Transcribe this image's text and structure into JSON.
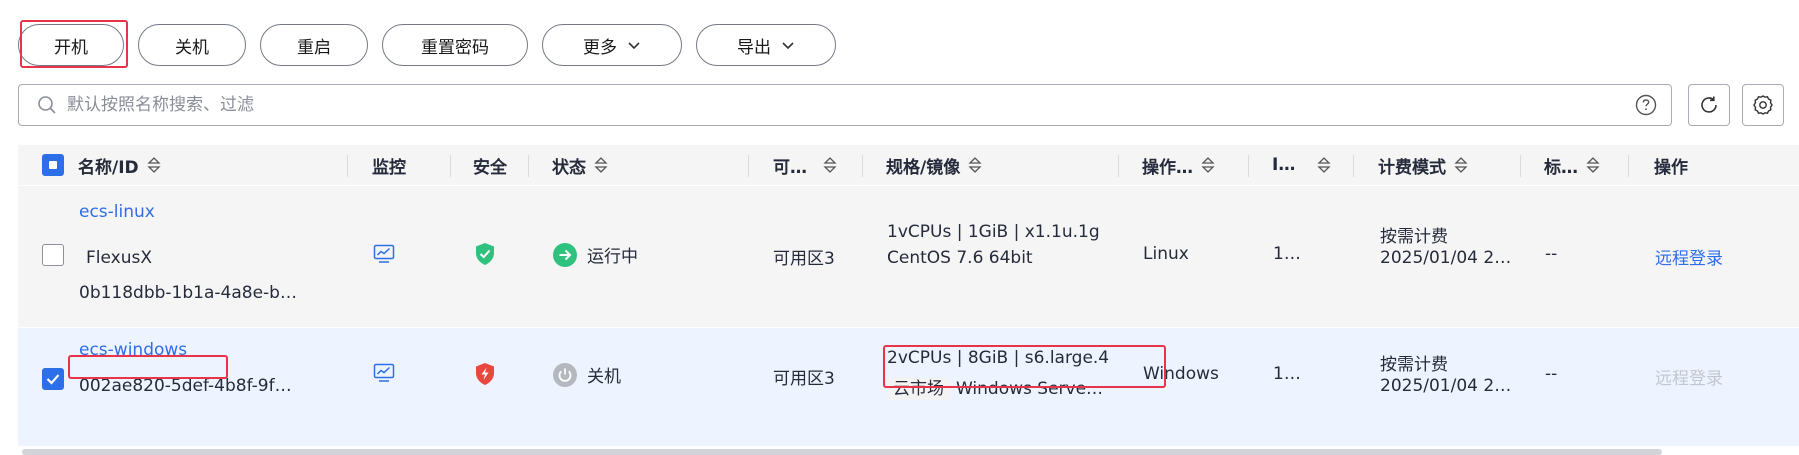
{
  "toolbar": {
    "start": "开机",
    "stop": "关机",
    "reboot": "重启",
    "reset_password": "重置密码",
    "more": "更多",
    "export": "导出"
  },
  "search": {
    "placeholder": "默认按照名称搜索、过滤"
  },
  "table": {
    "headers": {
      "name": "名称/ID",
      "monitor": "监控",
      "security": "安全",
      "status": "状态",
      "az": "可…",
      "spec": "规格/镜像",
      "os": "操作…",
      "ip": "I…",
      "billing": "计费模式",
      "tags": "标…",
      "ops": "操作"
    },
    "rows": [
      {
        "name": "ecs-linux",
        "sub_name": "FlexusX",
        "id": "0b118dbb-1b1a-4a8e-b…",
        "status": "运行中",
        "az": "可用区3",
        "spec": "1vCPUs | 1GiB | x1.1u.1g",
        "image": "CentOS 7.6 64bit",
        "os": "Linux",
        "ip": "1…",
        "billing": "按需计费",
        "billing_time": "2025/01/04 2…",
        "tags": "--",
        "op": "远程登录",
        "checked": false,
        "security_color": "#2ec27e"
      },
      {
        "name": "ecs-windows",
        "id": "002ae820-5def-4b8f-9f…",
        "status": "关机",
        "az": "可用区3",
        "spec": "2vCPUs | 8GiB | s6.large.4",
        "image_tag": "云市场",
        "image": "Windows Serve…",
        "os": "Windows",
        "ip": "1…",
        "billing": "按需计费",
        "billing_time": "2025/01/04 2…",
        "tags": "--",
        "op": "远程登录",
        "checked": true,
        "security_color": "#e8483f"
      }
    ]
  },
  "colors": {
    "accent": "#2d6ee9",
    "highlight_box": "#e8334a",
    "running": "#2ec27e",
    "stopped": "#b5b8bf"
  }
}
